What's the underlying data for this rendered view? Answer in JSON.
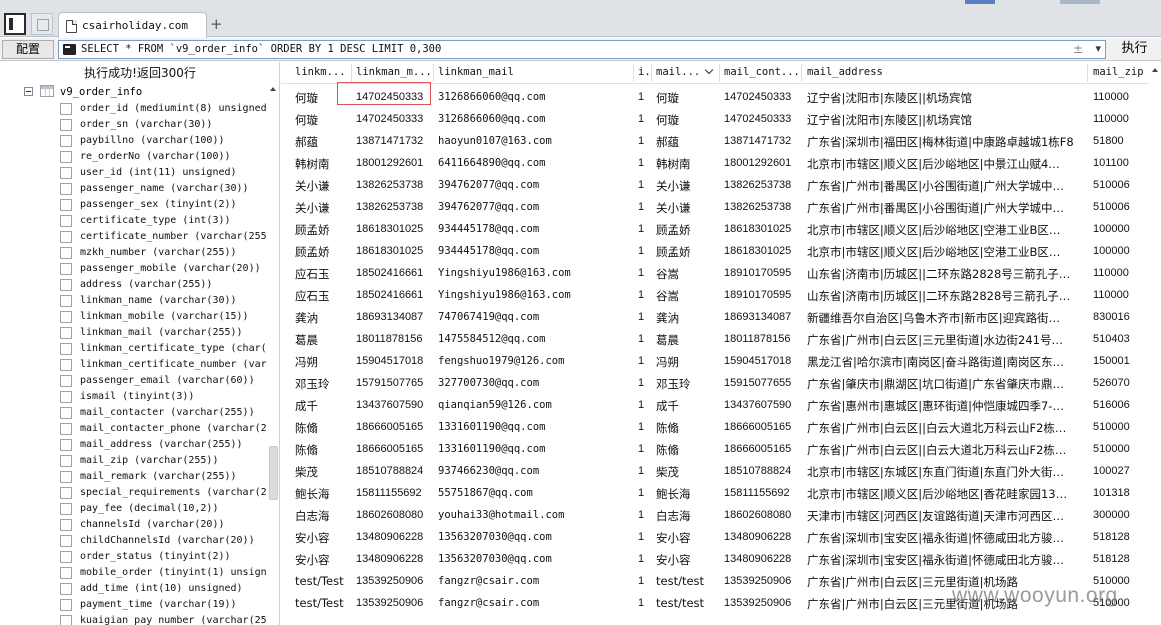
{
  "tab": {
    "title": "csairholiday.com",
    "add_symbol": "+"
  },
  "toolbar": {
    "config_label": "配置",
    "sql": "SELECT * FROM `v9_order_info` ORDER BY 1 DESC LIMIT 0,300",
    "plusminus": "±",
    "dropdown": "▾",
    "run_label": "执行"
  },
  "left": {
    "status": "执行成功!返回300行",
    "table_name": "v9_order_info",
    "fields": [
      "order_id (mediumint(8) unsigned",
      "order_sn (varchar(30))",
      "paybillno (varchar(100))",
      "re_orderNo (varchar(100))",
      "user_id (int(11) unsigned)",
      "passenger_name (varchar(30))",
      "passenger_sex (tinyint(2))",
      "certificate_type (int(3))",
      "certificate_number (varchar(255",
      "mzkh_number (varchar(255))",
      "passenger_mobile (varchar(20))",
      "address (varchar(255))",
      "linkman_name (varchar(30))",
      "linkman_mobile (varchar(15))",
      "linkman_mail (varchar(255))",
      "linkman_certificate_type (char(",
      "linkman_certificate_number (var",
      "passenger_email (varchar(60))",
      "ismail (tinyint(3))",
      "mail_contacter (varchar(255))",
      "mail_contacter_phone (varchar(2",
      "mail_address (varchar(255))",
      "mail_zip (varchar(255))",
      "mail_remark (varchar(255))",
      "special_requirements (varchar(2",
      "pay_fee (decimal(10,2))",
      "channelsId (varchar(20))",
      "childChannelsId (varchar(20))",
      "order_status (tinyint(2))",
      "mobile_order (tinyint(1) unsign",
      "add_time (int(10) unsigned)",
      "payment_time (varchar(19))",
      "kuaigian_pay_number (varchar(25"
    ]
  },
  "grid": {
    "headers": [
      "linkm...",
      "linkman_m...",
      "linkman_mail",
      "i.",
      "mail...",
      "mail_cont...",
      "mail_address",
      "mail_zip"
    ],
    "rows": [
      [
        "何璇",
        "14702450333",
        "3126866060@qq.com",
        "1",
        "何璇",
        "14702450333",
        "辽宁省|沈阳市|东陵区||机场宾馆",
        "110000"
      ],
      [
        "何璇",
        "14702450333",
        "3126866060@qq.com",
        "1",
        "何璇",
        "14702450333",
        "辽宁省|沈阳市|东陵区||机场宾馆",
        "110000"
      ],
      [
        "郝蕴",
        "13871471732",
        "haoyun0107@163.com",
        "1",
        "郝蕴",
        "13871471732",
        "广东省|深圳市|福田区|梅林街道|中康路卓越城1栋F8",
        "51800"
      ],
      [
        "韩树南",
        "18001292601",
        "6411664890@qq.com",
        "1",
        "韩树南",
        "18001292601",
        "北京市|市辖区|顺义区|后沙峪地区|中景江山赋4…",
        "101100"
      ],
      [
        "关小谦",
        "13826253738",
        "394762077@qq.com",
        "1",
        "关小谦",
        "13826253738",
        "广东省|广州市|番禺区|小谷围街道|广州大学城中…",
        "510006"
      ],
      [
        "关小谦",
        "13826253738",
        "394762077@qq.com",
        "1",
        "关小谦",
        "13826253738",
        "广东省|广州市|番禺区|小谷围街道|广州大学城中…",
        "510006"
      ],
      [
        "顾孟娇",
        "18618301025",
        "934445178@qq.com",
        "1",
        "顾孟娇",
        "18618301025",
        "北京市|市辖区|顺义区|后沙峪地区|空港工业B区…",
        "100000"
      ],
      [
        "顾孟娇",
        "18618301025",
        "934445178@qq.com",
        "1",
        "顾孟娇",
        "18618301025",
        "北京市|市辖区|顺义区|后沙峪地区|空港工业B区…",
        "100000"
      ],
      [
        "应石玉",
        "18502416661",
        "Yingshiyu1986@163.com",
        "1",
        "谷嵩",
        "18910170595",
        "山东省|济南市|历城区||二环东路2828号三箭孔子…",
        "110000"
      ],
      [
        "应石玉",
        "18502416661",
        "Yingshiyu1986@163.com",
        "1",
        "谷嵩",
        "18910170595",
        "山东省|济南市|历城区||二环东路2828号三箭孔子…",
        "110000"
      ],
      [
        "龚汭",
        "18693134087",
        "747067419@qq.com",
        "1",
        "龚汭",
        "18693134087",
        "新疆维吾尔自治区|乌鲁木齐市|新市区|迎宾路街…",
        "830016"
      ],
      [
        "葛晨",
        "18011878156",
        "1475584512@qq.com",
        "1",
        "葛晨",
        "18011878156",
        "广东省|广州市|白云区|三元里街道|水边街241号…",
        "510403"
      ],
      [
        "冯朔",
        "15904517018",
        "fengshuo1979@126.com",
        "1",
        "冯朔",
        "15904517018",
        "黑龙江省|哈尔滨市|南岗区|奋斗路街道|南岗区东…",
        "150001"
      ],
      [
        "邓玉玲",
        "15791507765",
        "327700730@qq.com",
        "1",
        "邓玉玲",
        "15915077655",
        "广东省|肇庆市|鼎湖区|坑口街道|广东省肇庆市鼎…",
        "526070"
      ],
      [
        "成千",
        "13437607590",
        "qianqian59@126.com",
        "1",
        "成千",
        "13437607590",
        "广东省|惠州市|惠城区|惠环街道|仲恺康城四季7-…",
        "516006"
      ],
      [
        "陈翛",
        "18666005165",
        "1331601190@qq.com",
        "1",
        "陈翛",
        "18666005165",
        "广东省|广州市|白云区||白云大道北万科云山F2栋…",
        "510000"
      ],
      [
        "陈翛",
        "18666005165",
        "1331601190@qq.com",
        "1",
        "陈翛",
        "18666005165",
        "广东省|广州市|白云区||白云大道北万科云山F2栋…",
        "510000"
      ],
      [
        "柴茂",
        "18510788824",
        "937466230@qq.com",
        "1",
        "柴茂",
        "18510788824",
        "北京市|市辖区|东城区|东直门街道|东直门外大街…",
        "100027"
      ],
      [
        "鲍长海",
        "15811155692",
        "55751867@qq.com",
        "1",
        "鲍长海",
        "15811155692",
        "北京市|市辖区|顺义区|后沙峪地区|香花畦家园13…",
        "101318"
      ],
      [
        "白志海",
        "18602608080",
        "youhai33@hotmail.com",
        "1",
        "白志海",
        "18602608080",
        "天津市|市辖区|河西区|友谊路街道|天津市河西区…",
        "300000"
      ],
      [
        "安小容",
        "13480906228",
        "13563207030@qq.com",
        "1",
        "安小容",
        "13480906228",
        "广东省|深圳市|宝安区|福永街道|怀德咸田北方骏…",
        "518128"
      ],
      [
        "安小容",
        "13480906228",
        "13563207030@qq.com",
        "1",
        "安小容",
        "13480906228",
        "广东省|深圳市|宝安区|福永街道|怀德咸田北方骏…",
        "518128"
      ],
      [
        "test/Test",
        "13539250906",
        "fangzr@csair.com",
        "1",
        "test/test",
        "13539250906",
        "广东省|广州市|白云区|三元里街道|机场路",
        "510000"
      ],
      [
        "test/Test",
        "13539250906",
        "fangzr@csair.com",
        "1",
        "test/test",
        "13539250906",
        "广东省|广州市|白云区|三元里街道|机场路",
        "510000"
      ]
    ]
  },
  "watermark": "www.wooyun.org"
}
